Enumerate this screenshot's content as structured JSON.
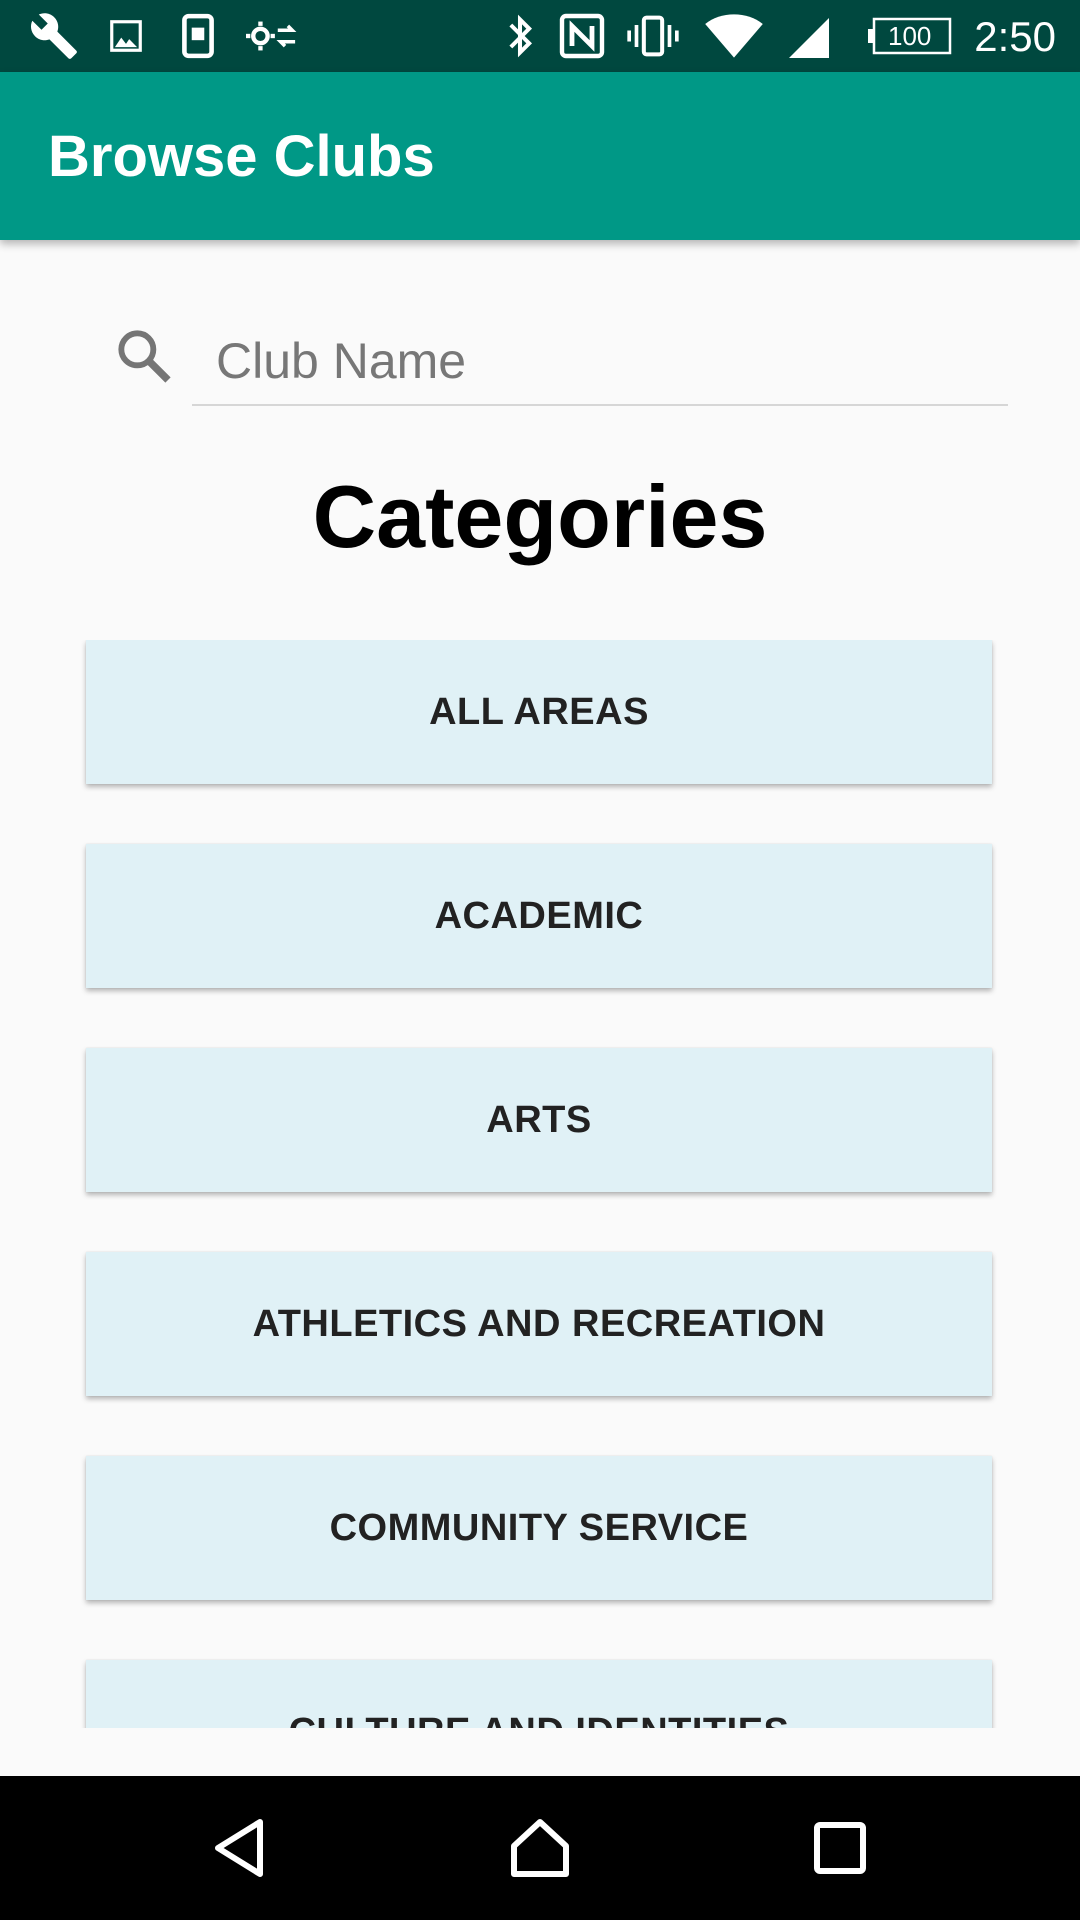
{
  "status_bar": {
    "icons": [
      "wrench-icon",
      "image-icon",
      "phone-screen-icon",
      "settings-sync-icon",
      "bluetooth-icon",
      "nfc-icon",
      "vibrate-icon",
      "wifi-icon",
      "cell-signal-icon",
      "battery-icon"
    ],
    "battery_level": "100",
    "time": "2:50"
  },
  "app_bar": {
    "title": "Browse Clubs",
    "color": "#009886"
  },
  "search": {
    "placeholder": "Club Name",
    "value": ""
  },
  "categories": {
    "heading": "Categories",
    "items": [
      {
        "label": "ALL AREAS"
      },
      {
        "label": "ACADEMIC"
      },
      {
        "label": "ARTS"
      },
      {
        "label": "ATHLETICS AND RECREATION"
      },
      {
        "label": "COMMUNITY SERVICE"
      },
      {
        "label": "CULTURE AND IDENTITIES"
      }
    ]
  },
  "nav_bar": {
    "buttons": [
      "back-icon",
      "home-icon",
      "recents-icon"
    ]
  }
}
